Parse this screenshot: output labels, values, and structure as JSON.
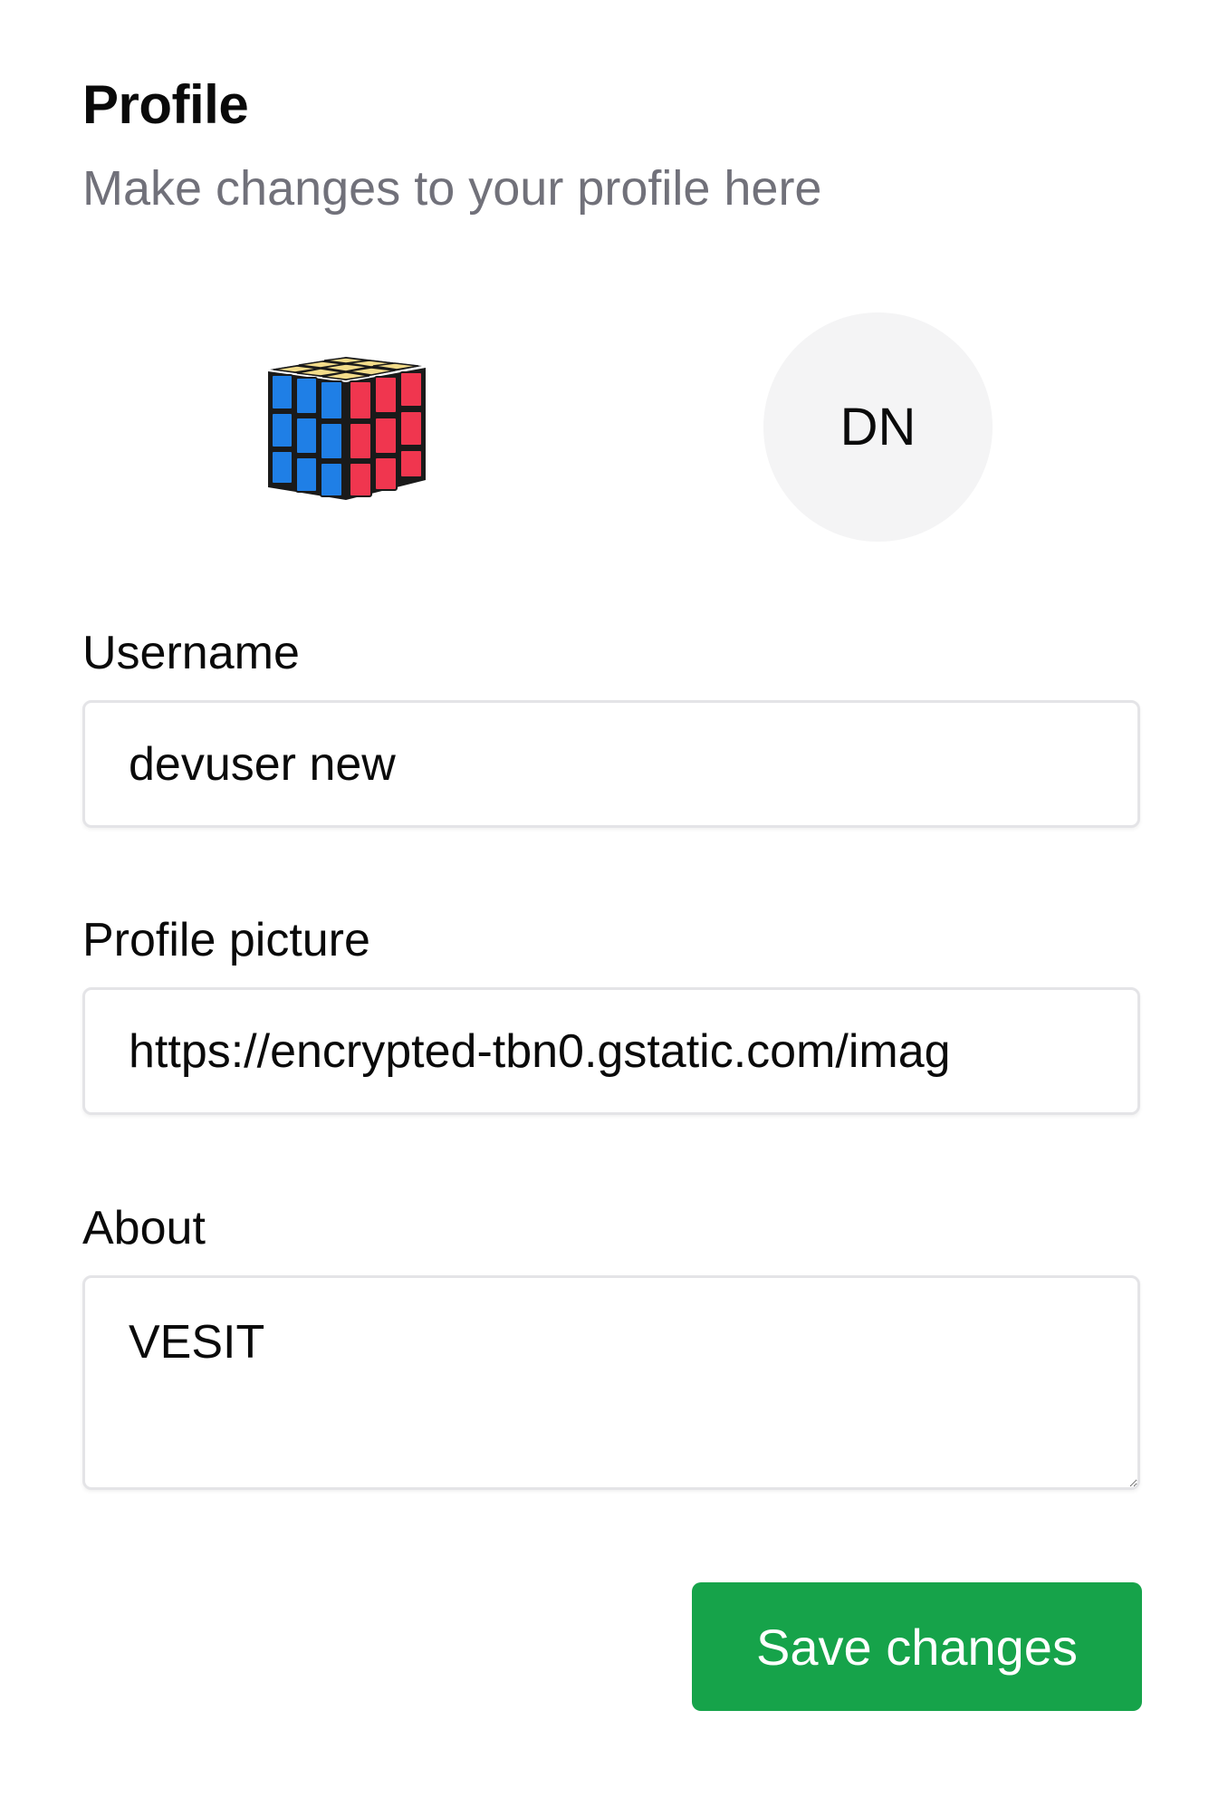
{
  "header": {
    "title": "Profile",
    "subtitle": "Make changes to your profile here"
  },
  "avatar": {
    "preview_icon": "rubiks-cube-image",
    "initials": "DN"
  },
  "form": {
    "username": {
      "label": "Username",
      "value": "devuser new"
    },
    "profile_picture": {
      "label": "Profile picture",
      "value": "https://encrypted-tbn0.gstatic.com/imag"
    },
    "about": {
      "label": "About",
      "value": "VESIT"
    }
  },
  "actions": {
    "save_label": "Save changes"
  },
  "colors": {
    "accent": "#16a34a",
    "muted_text": "#71717a",
    "border": "#e4e4e7",
    "avatar_bg": "#f4f4f5"
  }
}
